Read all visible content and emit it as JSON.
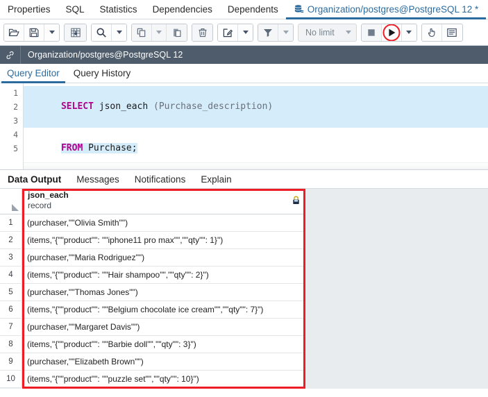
{
  "window": {
    "tabs": [
      {
        "label": "Properties",
        "icon": null,
        "active": false
      },
      {
        "label": "SQL",
        "icon": null,
        "active": false
      },
      {
        "label": "Statistics",
        "icon": null,
        "active": false
      },
      {
        "label": "Dependencies",
        "icon": null,
        "active": false
      },
      {
        "label": "Dependents",
        "icon": null,
        "active": false
      },
      {
        "label": "Organization/postgres@PostgreSQL 12 *",
        "icon": "database-icon",
        "active": true
      }
    ]
  },
  "toolbar": {
    "groups": [
      {
        "buttons": [
          {
            "name": "open-file-button",
            "icon": "open-folder-icon",
            "disabled": false
          },
          {
            "name": "save-file-button",
            "icon": "save-disk-icon",
            "disabled": false
          },
          {
            "name": "save-options-dropdown",
            "icon": "chevron-down-icon",
            "caret": true,
            "disabled": false
          }
        ]
      },
      {
        "buttons": [
          {
            "name": "edit-grid-button",
            "icon": "grid-edit-icon",
            "disabled": true
          }
        ]
      },
      {
        "buttons": [
          {
            "name": "find-button",
            "icon": "search-icon",
            "disabled": false
          },
          {
            "name": "find-options-dropdown",
            "icon": "chevron-down-icon",
            "caret": true,
            "disabled": false
          }
        ]
      },
      {
        "buttons": [
          {
            "name": "copy-button",
            "icon": "copy-icon",
            "disabled": true
          },
          {
            "name": "copy-options-dropdown",
            "icon": "chevron-down-icon",
            "caret": true,
            "disabled": true
          },
          {
            "name": "paste-button",
            "icon": "paste-icon",
            "disabled": true
          }
        ]
      },
      {
        "buttons": [
          {
            "name": "delete-row-button",
            "icon": "trash-icon",
            "disabled": true
          }
        ]
      },
      {
        "buttons": [
          {
            "name": "edit-button",
            "icon": "pencil-square-icon",
            "disabled": false
          },
          {
            "name": "edit-options-dropdown",
            "icon": "chevron-down-icon",
            "caret": true,
            "disabled": false
          }
        ]
      },
      {
        "buttons": [
          {
            "name": "filter-button",
            "icon": "funnel-icon",
            "disabled": true
          },
          {
            "name": "filter-options-dropdown",
            "icon": "chevron-down-icon",
            "caret": true,
            "disabled": true
          }
        ]
      }
    ],
    "row_limit": {
      "label": "No limit",
      "name": "row-limit-select"
    },
    "stop_button": {
      "name": "stop-query-button",
      "icon": "stop-square-icon"
    },
    "execute_button": {
      "name": "execute-query-button",
      "icon": "play-triangle-icon",
      "annotated": true
    },
    "execute_dropdown": {
      "name": "execute-options-dropdown",
      "icon": "chevron-down-icon"
    },
    "scratch_pad_button": {
      "name": "macros-hand-icon",
      "icon": "hand-pointer-icon"
    },
    "panel_button": {
      "name": "query-tool-panel-button",
      "icon": "panel-list-icon"
    },
    "annotation_color": "#ee1c25"
  },
  "connection": {
    "icon": "link-chain-icon",
    "title": "Organization/postgres@PostgreSQL 12",
    "bg_color": "#4e5c6b"
  },
  "editor": {
    "tabs": [
      {
        "label": "Query Editor",
        "active": true
      },
      {
        "label": "Query History",
        "active": false
      }
    ],
    "gutter_numbers": [
      "1",
      "2",
      "3",
      "4",
      "5"
    ],
    "lines": [
      {
        "segments": [
          {
            "text": "SELECT",
            "cls": "kw"
          },
          {
            "text": " json_each ",
            "cls": "fn"
          },
          {
            "text": "(Purchase_description)",
            "cls": "pn"
          }
        ],
        "selected_full": true
      },
      {
        "segments": [
          {
            "text": "FROM",
            "cls": "kw"
          },
          {
            "text": " Purchase;",
            "cls": "fn"
          }
        ],
        "selected_full": false
      },
      {
        "segments": [],
        "selected_full": false
      },
      {
        "segments": [],
        "selected_full": false
      },
      {
        "segments": [],
        "selected_full": false
      }
    ],
    "selection_color": "#d5ecfa",
    "keyword_color": "#b3008f"
  },
  "output": {
    "tabs": [
      {
        "label": "Data Output",
        "active": true
      },
      {
        "label": "Messages",
        "active": false
      },
      {
        "label": "Notifications",
        "active": false
      },
      {
        "label": "Explain",
        "active": false
      }
    ],
    "column": {
      "name": "json_each",
      "type": "record",
      "lock_icon": "lock-icon"
    },
    "rows": [
      {
        "n": "1",
        "value": "(purchaser,\"\"Olivia Smith\"\")"
      },
      {
        "n": "2",
        "value": "(items,\"{\"\"product\"\": \"\"iphone11 pro max\"\",\"\"qty\"\": 1}\")"
      },
      {
        "n": "3",
        "value": "(purchaser,\"\"Maria Rodriguez\"\")"
      },
      {
        "n": "4",
        "value": "(items,\"{\"\"product\"\": \"\"Hair shampoo\"\",\"\"qty\"\": 2}\")"
      },
      {
        "n": "5",
        "value": "(purchaser,\"\"Thomas Jones\"\")"
      },
      {
        "n": "6",
        "value": "(items,\"{\"\"product\"\": \"\"Belgium chocolate ice cream\"\",\"\"qty\"\": 7}\")"
      },
      {
        "n": "7",
        "value": "(purchaser,\"\"Margaret Davis\"\")"
      },
      {
        "n": "8",
        "value": "(items,\"{\"\"product\"\": \"\"Barbie doll\"\",\"\"qty\"\": 3}\")"
      },
      {
        "n": "9",
        "value": "(purchaser,\"\"Elizabeth Brown\"\")"
      },
      {
        "n": "10",
        "value": "(items,\"{\"\"product\"\": \"\"puzzle set\"\",\"\"qty\"\": 10}\")"
      }
    ],
    "annotation_color": "#ee1c25",
    "empty_area_color": "#e9ecef"
  }
}
